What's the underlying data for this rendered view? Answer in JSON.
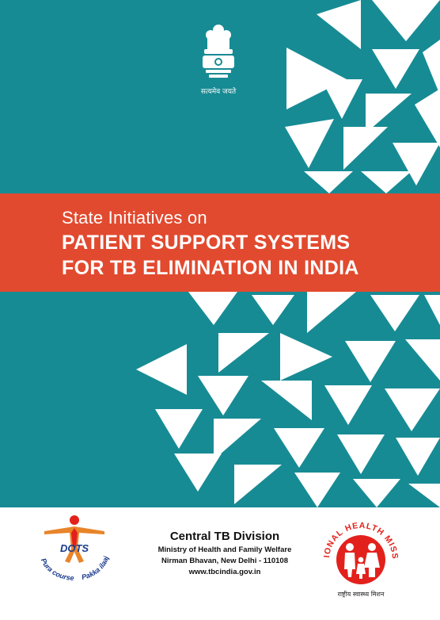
{
  "header": {
    "emblem_motto": "सत्यमेव जयते"
  },
  "title": {
    "subtitle": "State Initiatives on",
    "line1": "PATIENT SUPPORT SYSTEMS",
    "line2": "FOR TB ELIMINATION IN INDIA"
  },
  "footer": {
    "division": "Central TB Division",
    "ministry": "Ministry of Health and Family Welfare",
    "address": "Nirman Bhavan, New Delhi - 110108",
    "website": "www.tbcindia.gov.in"
  },
  "dots_logo": {
    "name": "DOTS",
    "tagline_left": "Pura course",
    "tagline_right": "Pakka ilaaj"
  },
  "nhm_logo": {
    "ring_text": "NATIONAL HEALTH MISSION",
    "hindi_text": "राष्ट्रीय स्वास्थ्य मिशन"
  },
  "colors": {
    "teal": "#178b94",
    "banner": "#e24a2f",
    "white": "#ffffff",
    "nhm_red": "#e3211c",
    "dots_orange": "#e8852a"
  }
}
